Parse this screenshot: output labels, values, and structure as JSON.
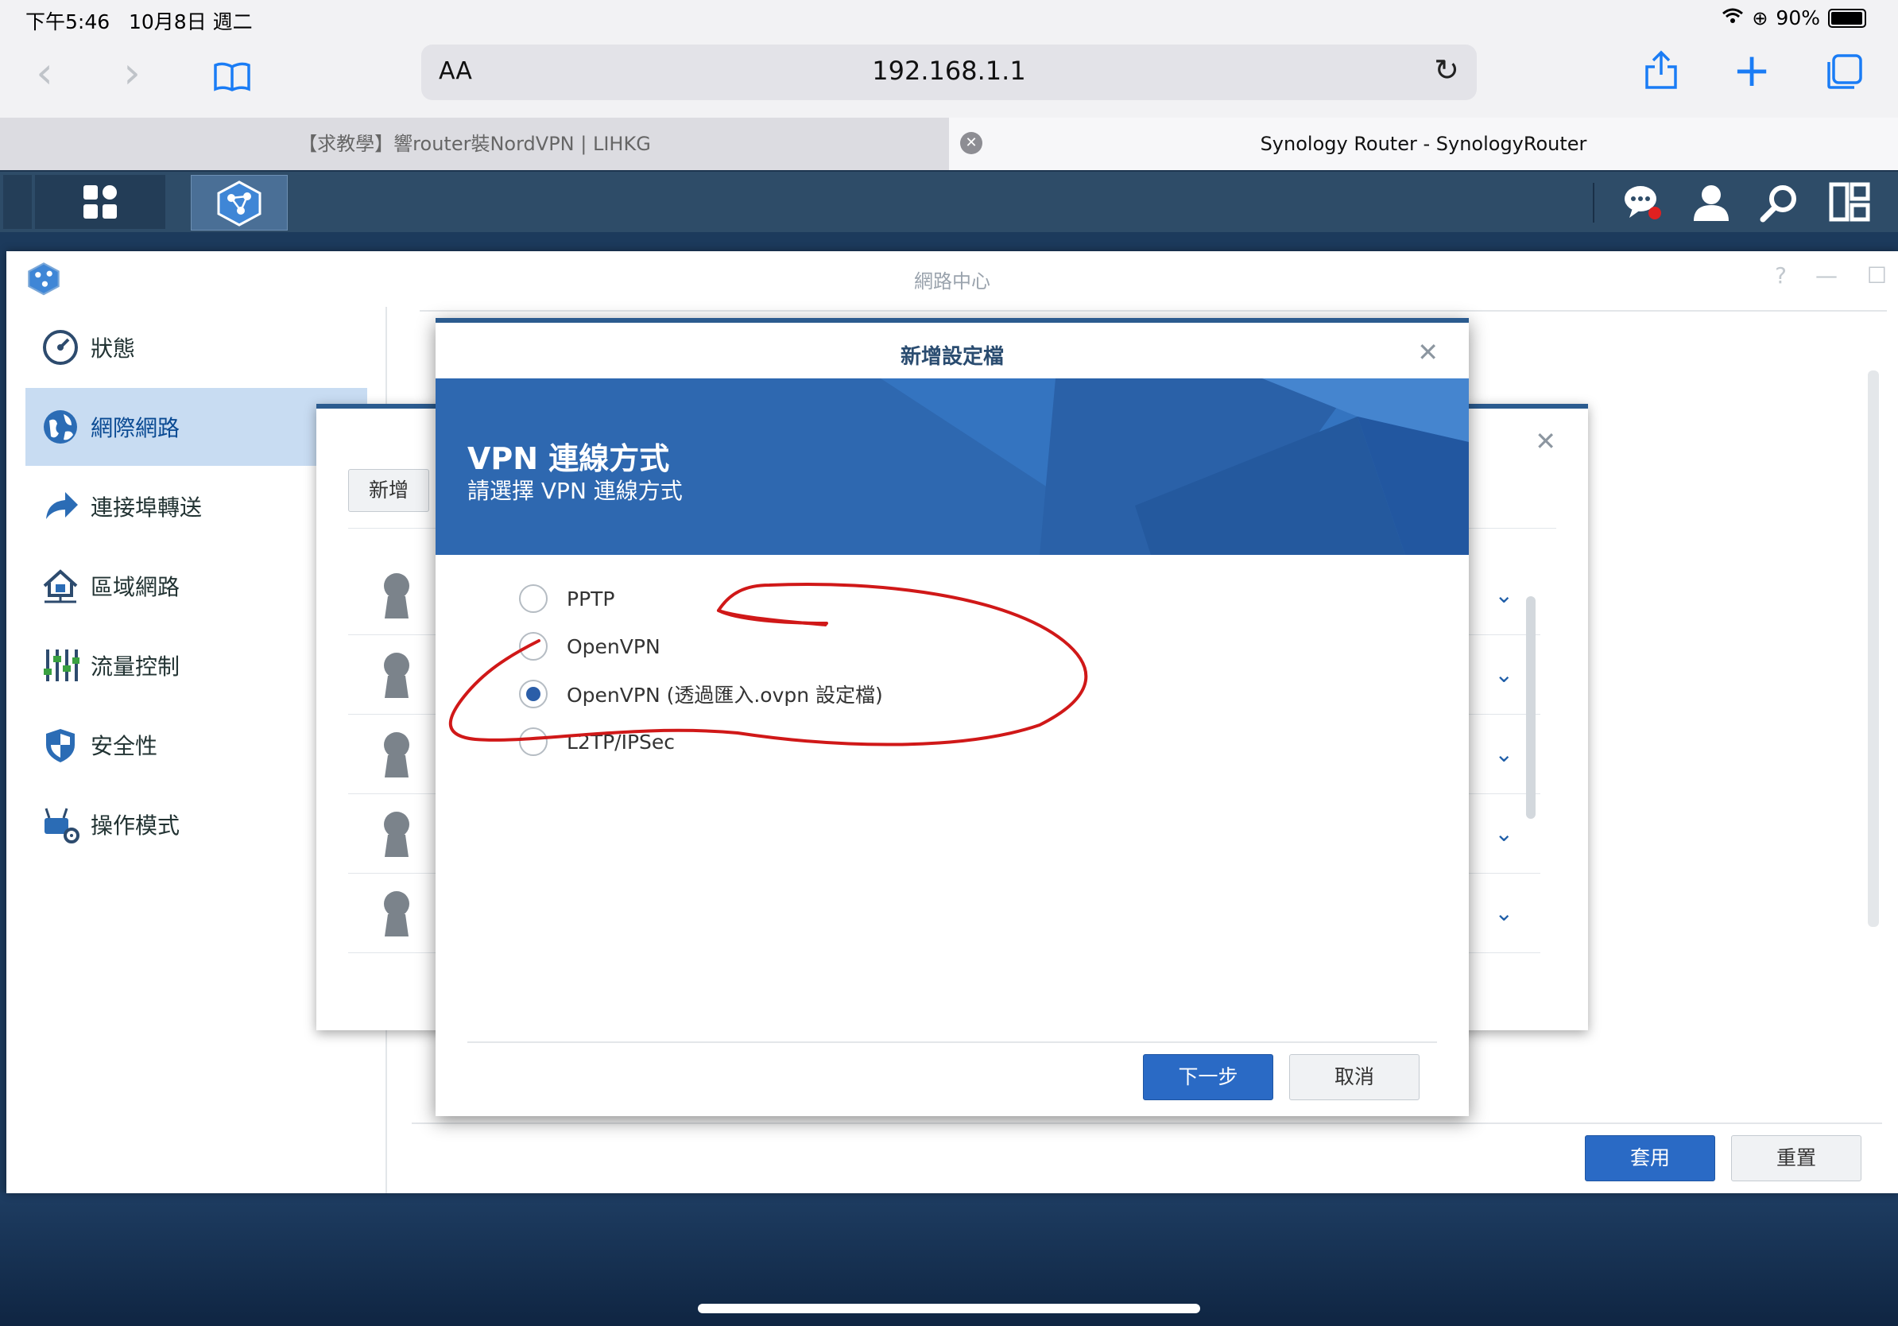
{
  "status_bar": {
    "time": "下午5:46",
    "date": "10月8日 週二",
    "battery": "90%"
  },
  "browser": {
    "address_aa": "AA",
    "url": "192.168.1.1",
    "tabs": [
      {
        "title": "【求教學】響router裝NordVPN | LIHKG"
      },
      {
        "title": "Synology Router - SynologyRouter"
      }
    ]
  },
  "window": {
    "title": "網路中心",
    "sidebar": [
      {
        "label": "狀態",
        "icon": "gauge-icon"
      },
      {
        "label": "網際網路",
        "icon": "globe-icon"
      },
      {
        "label": "連接埠轉送",
        "icon": "forward-arrow-icon"
      },
      {
        "label": "區域網路",
        "icon": "home-network-icon"
      },
      {
        "label": "流量控制",
        "icon": "sliders-icon"
      },
      {
        "label": "安全性",
        "icon": "shield-icon"
      },
      {
        "label": "操作模式",
        "icon": "router-gear-icon"
      }
    ],
    "apply_button": "套用",
    "reset_button": "重置"
  },
  "sub_dialog": {
    "add_button": "新增"
  },
  "dialog": {
    "title": "新增設定檔",
    "banner_title": "VPN 連線方式",
    "banner_subtitle": "請選擇 VPN 連線方式",
    "options": [
      {
        "label": "PPTP",
        "selected": false
      },
      {
        "label": "OpenVPN",
        "selected": false
      },
      {
        "label": "OpenVPN (透過匯入.ovpn 設定檔)",
        "selected": true
      },
      {
        "label": "L2TP/IPSec",
        "selected": false
      }
    ],
    "next_button": "下一步",
    "cancel_button": "取消"
  },
  "colors": {
    "accent": "#2a6ac5",
    "dsm_bar": "#2e4c68",
    "banner": "#2e68b0",
    "annotation": "#d01818"
  }
}
